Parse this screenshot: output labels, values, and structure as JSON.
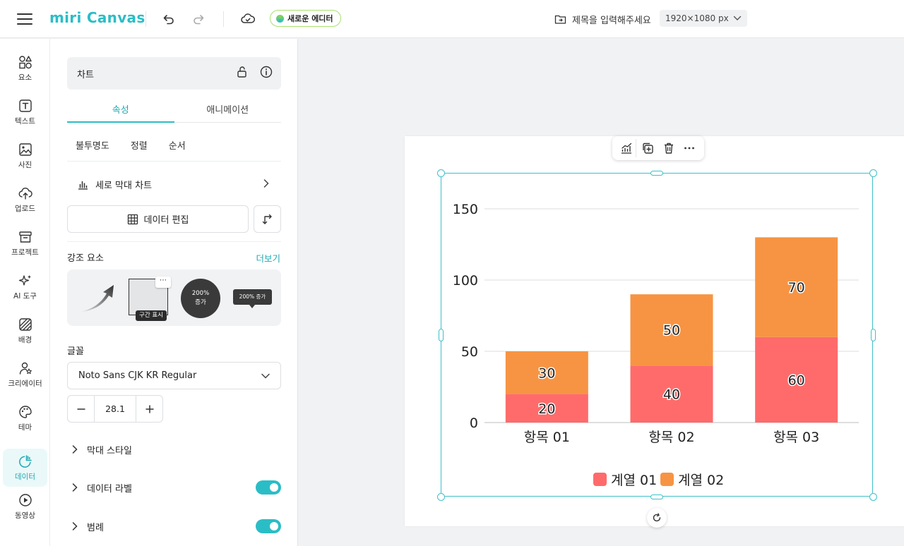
{
  "app": {
    "logo": "miri Canvas",
    "new_editor_label": "새로운 에디터",
    "doc_title": "제목을 입력해주세요",
    "canvas_size": "1920×1080 px"
  },
  "rail": {
    "items": [
      {
        "label": "요소",
        "icon": "shapes-icon"
      },
      {
        "label": "텍스트",
        "icon": "text-icon"
      },
      {
        "label": "사진",
        "icon": "photo-icon"
      },
      {
        "label": "업로드",
        "icon": "upload-icon"
      },
      {
        "label": "프로젝트",
        "icon": "archive-icon"
      },
      {
        "label": "AI 도구",
        "icon": "sparkle-icon"
      },
      {
        "label": "배경",
        "icon": "background-icon"
      },
      {
        "label": "크리에이터",
        "icon": "creator-icon"
      },
      {
        "label": "테마",
        "icon": "palette-icon"
      },
      {
        "label": "데이터",
        "icon": "data-chart-icon",
        "active": true
      },
      {
        "label": "동영상",
        "icon": "video-icon"
      }
    ]
  },
  "panel": {
    "header_title": "차트",
    "tabs": [
      {
        "label": "속성",
        "active": true
      },
      {
        "label": "애니메이션"
      }
    ],
    "subtabs": [
      "불투명도",
      "정렬",
      "순서"
    ],
    "chart_type_label": "세로 막대 차트",
    "data_edit_label": "데이터 편집",
    "highlight_title": "강조 요소",
    "more_label": "더보기",
    "highlight_items": {
      "range_label": "구간 표시",
      "circle_line1": "200%",
      "circle_line2": "증가",
      "tooltip_label": "200% 증가"
    },
    "font_title": "글꼴",
    "font_value": "Noto Sans CJK KR Regular",
    "font_size": "28.1",
    "accordion": [
      {
        "label": "막대 스타일",
        "toggle": false
      },
      {
        "label": "데이터 라벨",
        "toggle": true
      },
      {
        "label": "범례",
        "toggle": true
      }
    ]
  },
  "colors": {
    "accent": "#2bbdc6",
    "series1": "#ff6b6b",
    "series2": "#f79443"
  },
  "chart_data": {
    "type": "bar",
    "stacked": true,
    "categories": [
      "항목 01",
      "항목 02",
      "항목 03"
    ],
    "series": [
      {
        "name": "계열 01",
        "values": [
          20,
          40,
          60
        ],
        "color": "#ff6b6b"
      },
      {
        "name": "계열 02",
        "values": [
          30,
          50,
          70
        ],
        "color": "#f79443"
      }
    ],
    "ylim": [
      0,
      150
    ],
    "yticks": [
      0,
      50,
      100,
      150
    ],
    "grid": true,
    "legend": "bottom",
    "data_labels": true
  }
}
